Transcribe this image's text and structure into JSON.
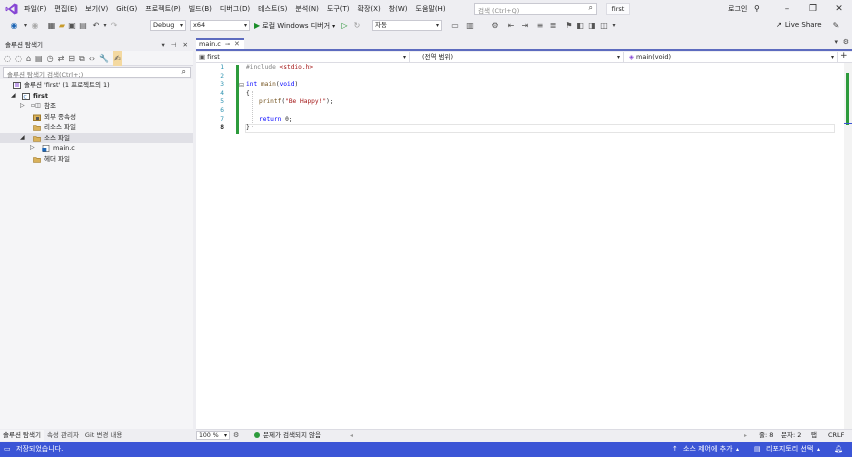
{
  "menu": {
    "items": [
      "파일(F)",
      "편집(E)",
      "보기(V)",
      "Git(G)",
      "프로젝트(P)",
      "빌드(B)",
      "디버그(D)",
      "테스트(S)",
      "분석(N)",
      "도구(T)",
      "확장(X)",
      "창(W)",
      "도움말(H)"
    ],
    "search_placeholder": "검색 (Ctrl+Q)",
    "solution_title": "first",
    "login": "로그인"
  },
  "toolbar": {
    "configuration": "Debug",
    "platform": "x64",
    "run_label": "로컬 Windows 디버거",
    "target": "자동",
    "live_share": "Live Share"
  },
  "solution_explorer": {
    "title": "솔루션 탐색기",
    "search_placeholder": "솔루션 탐색기 검색(Ctrl+;)",
    "tree": {
      "solution": "솔루션 'first' (1 프로젝트의 1)",
      "project": "first",
      "references": "참조",
      "external_deps": "외부 종속성",
      "resource_files": "리소스 파일",
      "source_files": "소스 파일",
      "main_c": "main.c",
      "header_files": "헤더 파일"
    },
    "bottom_tabs": [
      "솔루션 탐색기",
      "속성 관리자",
      "Git 변경 내용"
    ]
  },
  "editor": {
    "tab_title": "main.c",
    "nav": {
      "project": "first",
      "scope": "(전역 범위)",
      "member": "main(void)"
    },
    "line_numbers": [
      "1",
      "2",
      "3",
      "4",
      "5",
      "6",
      "7",
      "8"
    ],
    "code": {
      "l1_directive": "#include ",
      "l1_header": "<stdio.h>",
      "l3_kw": "int",
      "l3_fn": " main",
      "l3_rest": "(",
      "l3_void": "void",
      "l3_close": ")",
      "l4": "{",
      "l5_fn": "printf",
      "l5_open": "(",
      "l5_str": "\"Be Happy!\"",
      "l5_close": ");",
      "l7_kw": "return",
      "l7_rest": " 0;",
      "l8": "}"
    },
    "zoom": "100 %",
    "issues": "문제가 검색되지 않음",
    "line": "줄: 8",
    "char": "문자: 2",
    "tab_mode": "탭",
    "eol": "CRLF"
  },
  "statusbar": {
    "ready": "저장되었습니다.",
    "source_control": "소스 제어에 추가",
    "repository": "리포지토리 선택"
  },
  "colors": {
    "accent": "#3b55d6",
    "tab_accent": "#5d6bbf",
    "change_bar": "#2d9b3c",
    "keyword": "#0000ff",
    "string": "#a31515"
  }
}
